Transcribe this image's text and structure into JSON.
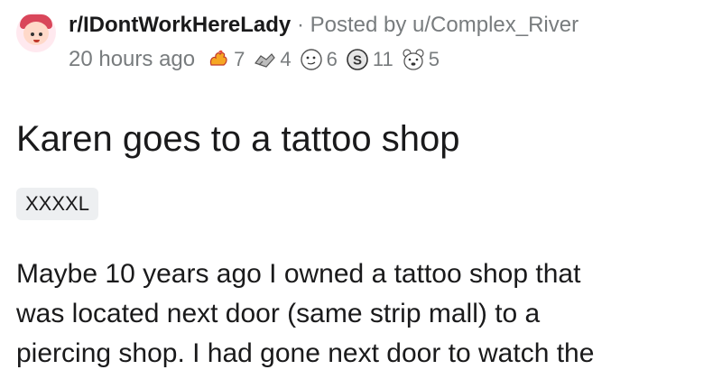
{
  "post": {
    "subreddit": "r/IDontWorkHereLady",
    "separator": "·",
    "posted_by": "Posted by u/Complex_River",
    "time_ago": "20 hours ago",
    "awards": [
      {
        "icon": "hand-flame-icon",
        "count": "7"
      },
      {
        "icon": "hands-shake-icon",
        "count": "4"
      },
      {
        "icon": "face-blush-icon",
        "count": "6"
      },
      {
        "icon": "coin-s-icon",
        "count": "11"
      },
      {
        "icon": "bear-face-icon",
        "count": "5"
      }
    ],
    "title": "Karen goes to a tattoo shop",
    "flair": "XXXXL",
    "body_lines": [
      "Maybe 10 years ago I owned a tattoo shop that",
      "was located next door (same strip mall) to a",
      "piercing shop. I had gone next door to watch the"
    ]
  }
}
